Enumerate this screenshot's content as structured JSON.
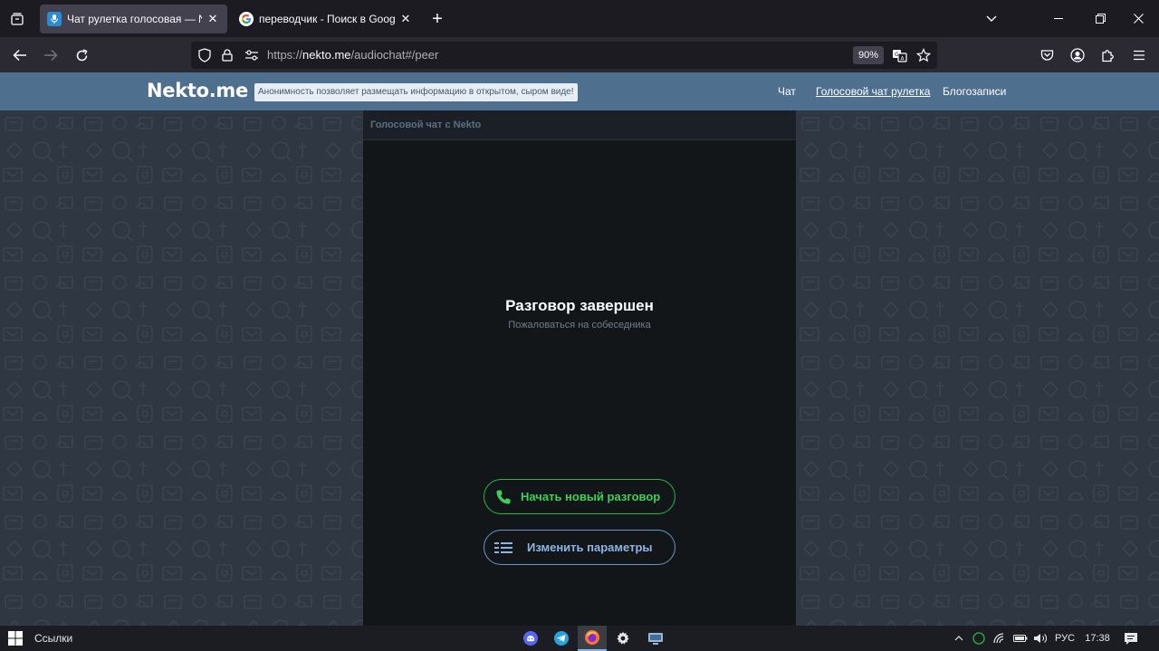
{
  "browser": {
    "tabs": [
      {
        "title": "Чат рулетка голосовая — Nekto",
        "active": true
      },
      {
        "title": "переводчик - Поиск в Google",
        "active": false
      }
    ],
    "url": {
      "prefix": "https://",
      "host": "nekto.me",
      "path": "/audiochat#/peer"
    },
    "zoom": "90%"
  },
  "site": {
    "logo": "Nekto.me",
    "tagline": "Анонимность позволяет размещать информацию в открытом, сыром виде!",
    "nav": [
      "Чат",
      "Голосовой чат рулетка",
      "Блогозаписи"
    ]
  },
  "chat": {
    "header": "Голосовой чат с Nekto",
    "ended_title": "Разговор завершен",
    "report_link": "Пожаловаться на собеседника",
    "new_chat_button": "Начать новый разговор",
    "params_button": "Изменить параметры"
  },
  "taskbar": {
    "links_label": "Ссылки",
    "language": "РУС",
    "time": "17:38"
  },
  "colors": {
    "site_header": "#4f6f8f",
    "accent_green": "#3fd059",
    "accent_blue": "#8cb5e6",
    "panel_bg": "#121619",
    "page_bg": "#2f3842"
  }
}
